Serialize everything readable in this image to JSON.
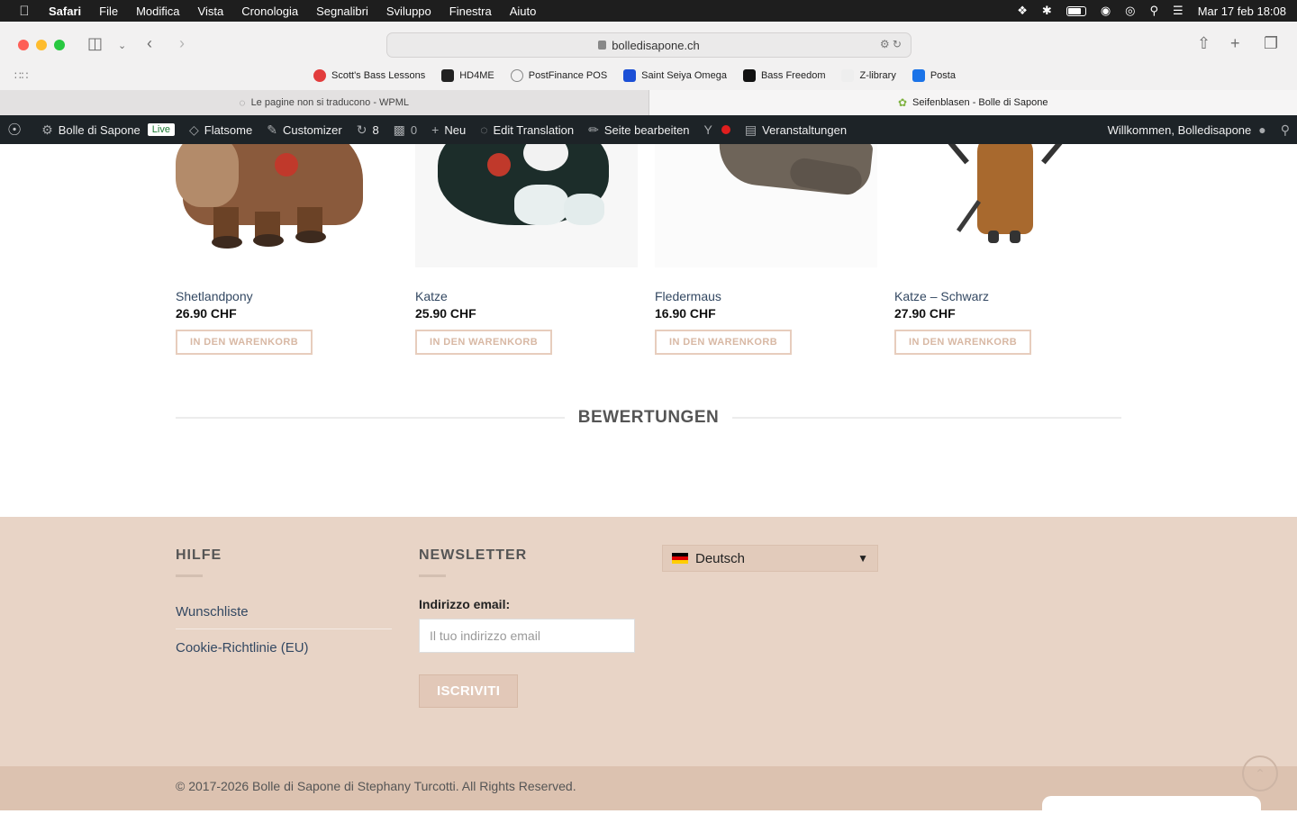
{
  "menubar": {
    "items": [
      "Safari",
      "File",
      "Modifica",
      "Vista",
      "Cronologia",
      "Segnalibri",
      "Sviluppo",
      "Finestra",
      "Aiuto"
    ],
    "datetime": "Mar 17 feb  18:08"
  },
  "browser": {
    "url": "bolledisapone.ch",
    "bookmarks": [
      "Scott's Bass Lessons",
      "HD4ME",
      "PostFinance POS",
      "Saint Seiya Omega",
      "Bass Freedom",
      "Z-library",
      "Posta"
    ],
    "tabs": [
      {
        "title": "Le pagine non si traducono - WPML"
      },
      {
        "title": "Seifenblasen - Bolle di Sapone"
      }
    ]
  },
  "adminbar": {
    "site": "Bolle di Sapone",
    "live": "Live",
    "flatsome": "Flatsome",
    "customizer": "Customizer",
    "updates": "8",
    "comments": "0",
    "new": "Neu",
    "edit_translation": "Edit Translation",
    "edit_page": "Seite bearbeiten",
    "events": "Veranstaltungen",
    "welcome": "Willkommen, Bolledisapone"
  },
  "products": [
    {
      "name": "Shetlandpony",
      "price": "26.90 CHF",
      "button": "IN DEN WARENKORB"
    },
    {
      "name": "Katze",
      "price": "25.90 CHF",
      "button": "IN DEN WARENKORB"
    },
    {
      "name": "Fledermaus",
      "price": "16.90 CHF",
      "button": "IN DEN WARENKORB"
    },
    {
      "name": "Katze – Schwarz",
      "price": "27.90 CHF",
      "button": "IN DEN WARENKORB"
    }
  ],
  "reviews_title": "BEWERTUNGEN",
  "footer": {
    "help_title": "HILFE",
    "help_links": [
      "Wunschliste",
      "Cookie-Richtlinie (EU)"
    ],
    "newsletter_title": "NEWSLETTER",
    "email_label": "Indirizzo email:",
    "email_placeholder": "Il tuo indirizzo email",
    "subscribe": "ISCRIVITI",
    "language": "Deutsch",
    "copyright": "© 2017-2026 Bolle di Sapone di Stephany Turcotti. All Rights Reserved."
  }
}
